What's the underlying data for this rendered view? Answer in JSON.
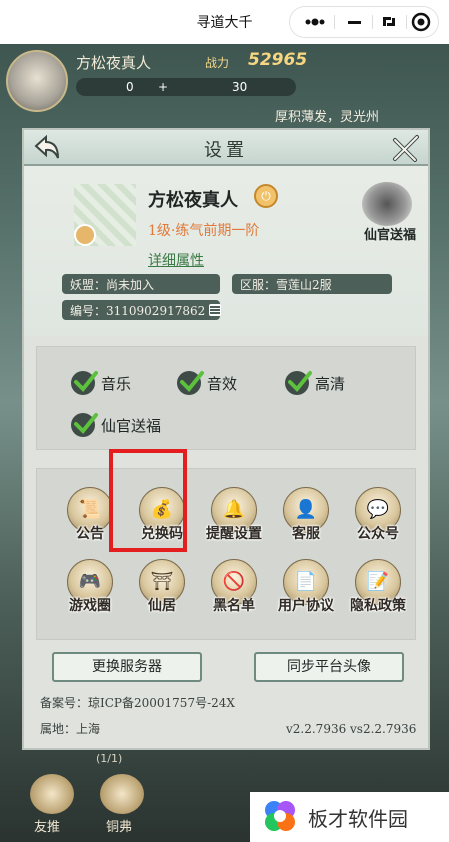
{
  "mini_program": {
    "title": "寻道大千"
  },
  "hud": {
    "player_name": "方松夜真人",
    "power_label": "战力",
    "power_value": "52965",
    "stat_a": "0",
    "stat_plus": "+",
    "stat_b": "30",
    "slogan": "厚积薄发，灵光州"
  },
  "dialog": {
    "title": "设置",
    "profile": {
      "name": "方松夜真人",
      "level": "1级·练气前期一阶",
      "detail_link": "详细属性",
      "alliance": "妖盟：尚未加入",
      "server": "区服：雪莲山2服",
      "id": "编号：3110902917862",
      "xianguan_label": "仙官送福"
    },
    "options": [
      {
        "label": "音乐",
        "checked": true
      },
      {
        "label": "音效",
        "checked": true
      },
      {
        "label": "高清",
        "checked": true
      },
      {
        "label": "仙官送福",
        "checked": true
      }
    ],
    "functions": [
      {
        "label": "公告",
        "icon": "scroll-icon",
        "glyph": "📜"
      },
      {
        "label": "兑换码",
        "icon": "money-bag-icon",
        "glyph": "💰"
      },
      {
        "label": "提醒设置",
        "icon": "bell-icon",
        "glyph": "🔔"
      },
      {
        "label": "客服",
        "icon": "customer-service-icon",
        "glyph": "👤"
      },
      {
        "label": "公众号",
        "icon": "wechat-icon",
        "glyph": "💬"
      },
      {
        "label": "游戏圈",
        "icon": "gamepad-icon",
        "glyph": "🎮"
      },
      {
        "label": "仙居",
        "icon": "pavilion-icon",
        "glyph": "⛩"
      },
      {
        "label": "黑名单",
        "icon": "blacklist-icon",
        "glyph": "🚫"
      },
      {
        "label": "用户协议",
        "icon": "agreement-icon",
        "glyph": "📄"
      },
      {
        "label": "隐私政策",
        "icon": "privacy-policy-icon",
        "glyph": "📝"
      }
    ],
    "buttons": {
      "switch_server": "更换服务器",
      "sync_avatar": "同步平台头像"
    },
    "footer": {
      "icp": "备案号：琼ICP备20001757号-24X",
      "location": "属地：上海",
      "version": "v2.2.7936 vs2.2.7936"
    }
  },
  "bottom": {
    "page_count": "(1/1)",
    "items": [
      "友推",
      "铜弗"
    ]
  },
  "watermark": {
    "text": "板才软件园"
  },
  "colors": {
    "highlight": "#e41e1e",
    "check_bg": "#3f4b47",
    "check_mark": "#5cc13c",
    "level_text": "#e07a3b",
    "detail_link": "#3b7a45"
  }
}
